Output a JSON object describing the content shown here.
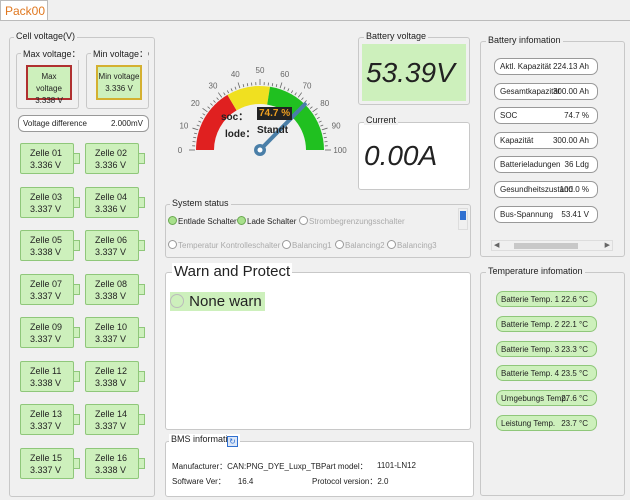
{
  "tab": "Pack00",
  "cell_voltage": {
    "title": "Cell voltage(V)",
    "max_label": "Max voltage：C",
    "min_label": "Min voltage：C",
    "max_inner": "Max voltage",
    "max_value": "3.338 V",
    "min_inner": "Min voltage",
    "min_value": "3.336 V",
    "diff_label": "Voltage difference",
    "diff_value": "2.000mV",
    "cells": [
      {
        "name": "Zelle 01",
        "value": "3.336 V"
      },
      {
        "name": "Zelle 02",
        "value": "3.336 V"
      },
      {
        "name": "Zelle 03",
        "value": "3.337 V"
      },
      {
        "name": "Zelle 04",
        "value": "3.336 V"
      },
      {
        "name": "Zelle 05",
        "value": "3.338 V"
      },
      {
        "name": "Zelle 06",
        "value": "3.337 V"
      },
      {
        "name": "Zelle 07",
        "value": "3.337 V"
      },
      {
        "name": "Zelle 08",
        "value": "3.338 V"
      },
      {
        "name": "Zelle 09",
        "value": "3.337 V"
      },
      {
        "name": "Zelle 10",
        "value": "3.337 V"
      },
      {
        "name": "Zelle 11",
        "value": "3.338 V"
      },
      {
        "name": "Zelle 12",
        "value": "3.338 V"
      },
      {
        "name": "Zelle 13",
        "value": "3.337 V"
      },
      {
        "name": "Zelle 14",
        "value": "3.337 V"
      },
      {
        "name": "Zelle 15",
        "value": "3.337 V"
      },
      {
        "name": "Zelle 16",
        "value": "3.338 V"
      }
    ]
  },
  "gauge": {
    "ticks": [
      "0",
      "10",
      "20",
      "30",
      "40",
      "50",
      "60",
      "70",
      "80",
      "90",
      "100"
    ],
    "soc_label": "soc：",
    "soc_value": "74.7 %",
    "mode_label": "lode：",
    "mode_value": "Standt",
    "needle_percent": 74.7
  },
  "battery_voltage": {
    "title": "Battery voltage",
    "value": "53.39V"
  },
  "current": {
    "title": "Current",
    "value": "0.00A"
  },
  "battery_info": {
    "title": "Battery infomation",
    "rows": [
      {
        "label": "Aktl. Kapazität",
        "value": "224.13 Ah"
      },
      {
        "label": "Gesamtkapazität",
        "value": "300.00 Ah"
      },
      {
        "label": "SOC",
        "value": "74.7 %"
      },
      {
        "label": "Kapazität",
        "value": "300.00 Ah"
      },
      {
        "label": "Batterieladungen",
        "value": "36 Ldg"
      },
      {
        "label": "Gesundheitszustand",
        "value": "100.0 %"
      },
      {
        "label": "Bus-Spannung",
        "value": "53.41 V"
      }
    ]
  },
  "system_status": {
    "title": "System status",
    "items": [
      {
        "label": "Entlade Schalter",
        "on": true
      },
      {
        "label": "Lade Schalter",
        "on": true
      },
      {
        "label": "Strombegrenzungsschalter",
        "on": false
      },
      {
        "label": "Temperatur Kontrolleschalter",
        "on": false
      },
      {
        "label": "Balancing1",
        "on": false
      },
      {
        "label": "Balancing2",
        "on": false
      },
      {
        "label": "Balancing3",
        "on": false
      }
    ]
  },
  "warn": {
    "title": "Warn and Protect",
    "item": "None warn"
  },
  "temperature": {
    "title": "Temperature infomation",
    "rows": [
      {
        "label": "Batterie Temp. 1",
        "value": "22.6 °C"
      },
      {
        "label": "Batterie Temp. 2",
        "value": "22.1 °C"
      },
      {
        "label": "Batterie Temp. 3",
        "value": "23.3 °C"
      },
      {
        "label": "Batterie Temp. 4",
        "value": "23.5 °C"
      },
      {
        "label": "Umgebungs Temp.",
        "value": "27.6 °C"
      },
      {
        "label": "Leistung Temp.",
        "value": "23.7 °C"
      }
    ]
  },
  "bms": {
    "title": "BMS information",
    "manufacturer_label": "Manufacturer：",
    "manufacturer_value": "CAN:PNG_DYE_Luxp_TB",
    "part_label": "Part model：",
    "part_value": "1101-LN12",
    "software_label": "Software Ver：",
    "software_value": "16.4",
    "protocol_label": "Protocol version：",
    "protocol_value": "2.0"
  }
}
